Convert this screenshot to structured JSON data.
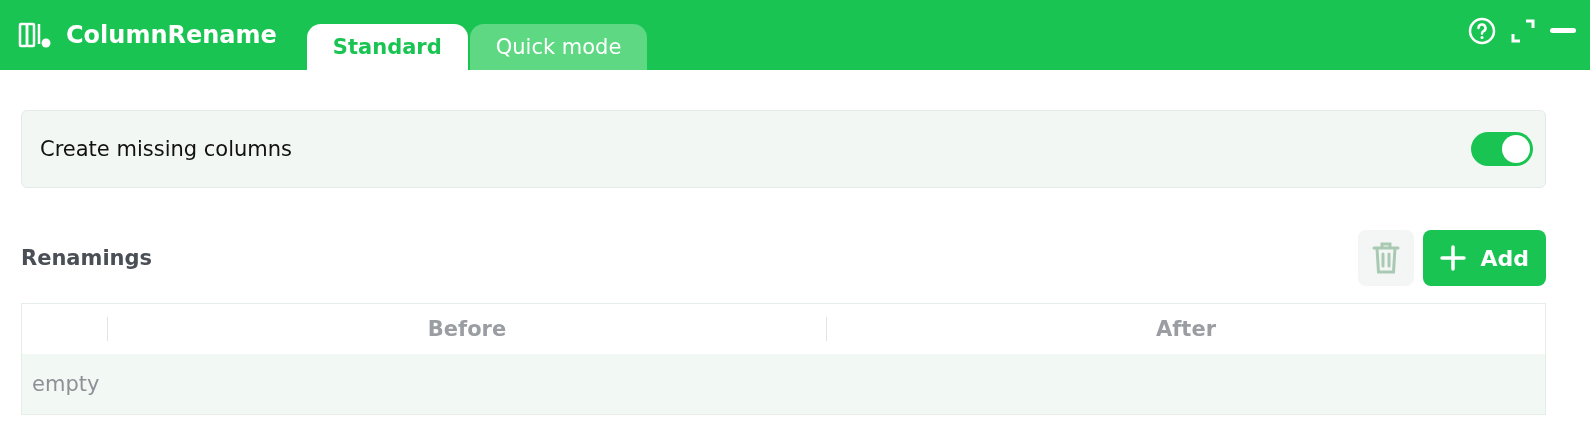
{
  "app": {
    "title": "ColumnRename"
  },
  "tabs": [
    {
      "label": "Standard",
      "selected": true
    },
    {
      "label": "Quick mode",
      "selected": false
    }
  ],
  "option": {
    "label": "Create missing columns",
    "on": true
  },
  "section": {
    "title": "Renamings",
    "delete_button": {
      "disabled": true
    },
    "add_button": {
      "label": "Add"
    }
  },
  "table": {
    "columns": [
      "Before",
      "After"
    ],
    "empty_text": "empty"
  }
}
